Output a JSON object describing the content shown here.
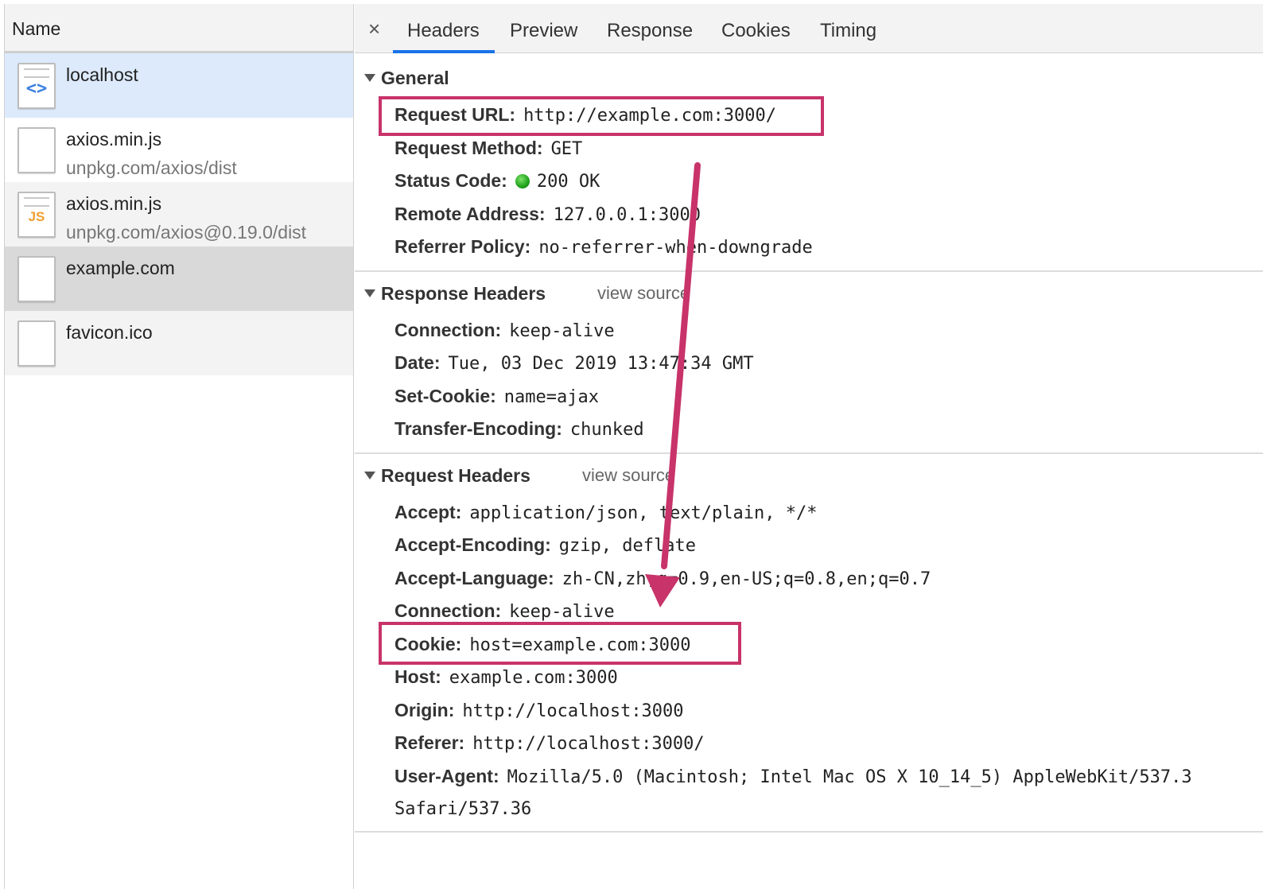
{
  "left_panel": {
    "column_header": "Name",
    "requests": [
      {
        "name": "localhost",
        "path": "",
        "icon": "html-document-icon"
      },
      {
        "name": "axios.min.js",
        "path": "unpkg.com/axios/dist",
        "icon": "blank-document-icon"
      },
      {
        "name": "axios.min.js",
        "path": "unpkg.com/axios@0.19.0/dist",
        "icon": "js-document-icon"
      },
      {
        "name": "example.com",
        "path": "",
        "icon": "blank-document-icon"
      },
      {
        "name": "favicon.ico",
        "path": "",
        "icon": "blank-document-icon"
      }
    ],
    "selected_index": 3
  },
  "tabs": {
    "close_glyph": "×",
    "items": [
      "Headers",
      "Preview",
      "Response",
      "Cookies",
      "Timing"
    ],
    "active": "Headers",
    "active_color": "#1a73e8"
  },
  "general": {
    "title": "General",
    "rows": [
      {
        "key": "Request URL:",
        "value": "http://example.com:3000/"
      },
      {
        "key": "Request Method:",
        "value": "GET"
      },
      {
        "key": "Status Code:",
        "value": "200 OK"
      },
      {
        "key": "Remote Address:",
        "value": "127.0.0.1:3000"
      },
      {
        "key": "Referrer Policy:",
        "value": "no-referrer-when-downgrade"
      }
    ]
  },
  "response_headers": {
    "title": "Response Headers",
    "view_source": "view source",
    "rows": [
      {
        "key": "Connection:",
        "value": "keep-alive"
      },
      {
        "key": "Date:",
        "value": "Tue, 03 Dec 2019 13:47:34 GMT"
      },
      {
        "key": "Set-Cookie:",
        "value": "name=ajax"
      },
      {
        "key": "Transfer-Encoding:",
        "value": "chunked"
      }
    ]
  },
  "request_headers": {
    "title": "Request Headers",
    "view_source": "view source",
    "rows": [
      {
        "key": "Accept:",
        "value": "application/json, text/plain, */*"
      },
      {
        "key": "Accept-Encoding:",
        "value": "gzip, deflate"
      },
      {
        "key": "Accept-Language:",
        "value": "zh-CN,zh;q=0.9,en-US;q=0.8,en;q=0.7"
      },
      {
        "key": "Connection:",
        "value": "keep-alive"
      },
      {
        "key": "Cookie:",
        "value": "host=example.com:3000"
      },
      {
        "key": "Host:",
        "value": "example.com:3000"
      },
      {
        "key": "Origin:",
        "value": "http://localhost:3000"
      },
      {
        "key": "Referer:",
        "value": "http://localhost:3000/"
      },
      {
        "key": "User-Agent:",
        "value": "Mozilla/5.0 (Macintosh; Intel Mac OS X 10_14_5) AppleWebKit/537.3"
      }
    ],
    "user_agent_wrap": "Safari/537.36"
  },
  "annotation": {
    "color": "#c8336a",
    "status_dot_color": "#1fa01a"
  }
}
